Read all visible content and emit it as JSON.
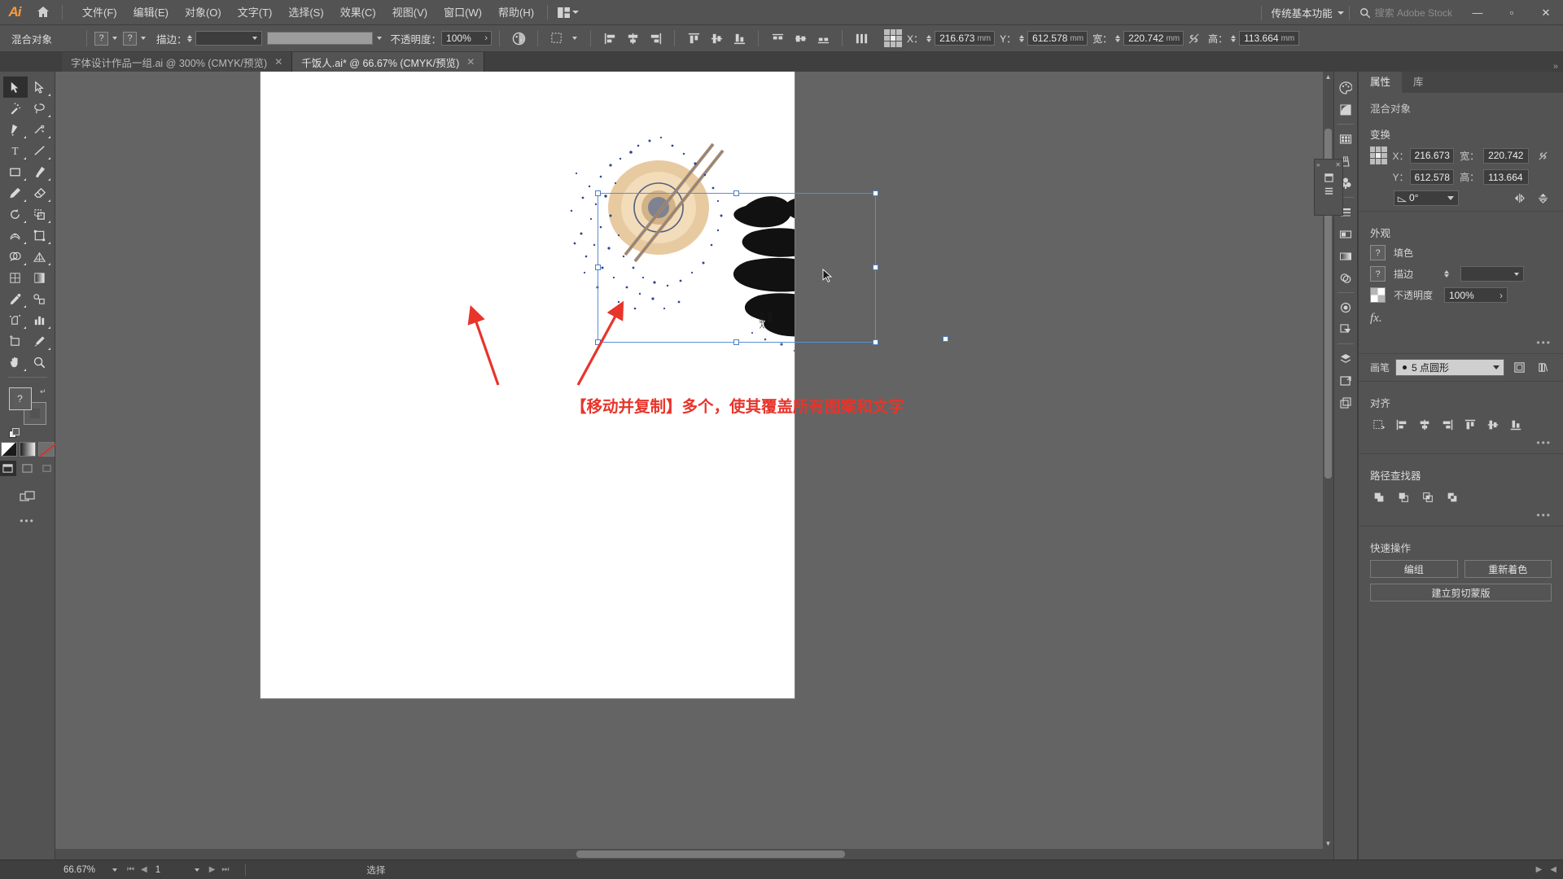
{
  "app": {
    "logo": "Ai",
    "home_icon": "home-icon",
    "workspace": "传统基本功能",
    "search_placeholder": "搜索 Adobe Stock",
    "search_icon": "search-icon",
    "window_buttons": {
      "minimize": "—",
      "maximize": "▫",
      "close": "✕"
    }
  },
  "menubar": {
    "items": [
      {
        "label": "文件(F)"
      },
      {
        "label": "编辑(E)"
      },
      {
        "label": "对象(O)"
      },
      {
        "label": "文字(T)"
      },
      {
        "label": "选择(S)"
      },
      {
        "label": "效果(C)"
      },
      {
        "label": "视图(V)"
      },
      {
        "label": "窗口(W)"
      },
      {
        "label": "帮助(H)"
      }
    ],
    "arrange_icon": "arrange-documents-icon"
  },
  "controlbar": {
    "object_label": "混合对象",
    "fill_swatch": "?",
    "stroke_swatch": "?",
    "stroke_label": "描边：",
    "stroke_value": "",
    "opacity_label": "不透明度：",
    "opacity_value": "100%",
    "icons": [
      {
        "name": "recolor-artwork-icon"
      },
      {
        "name": "select-similar-icon"
      },
      {
        "name": "align-left-icon"
      },
      {
        "name": "align-center-horizontal-icon"
      },
      {
        "name": "align-right-icon"
      },
      {
        "name": "align-top-icon"
      },
      {
        "name": "align-center-vertical-icon"
      },
      {
        "name": "align-bottom-icon"
      },
      {
        "name": "distribute-top-icon"
      },
      {
        "name": "distribute-center-icon"
      },
      {
        "name": "distribute-bottom-icon"
      },
      {
        "name": "distribute-spacing-icon"
      }
    ],
    "transform": {
      "ref_point_icon": "reference-point-grid",
      "x_label": "X：",
      "x_value": "216.673",
      "x_unit": "mm",
      "y_label": "Y：",
      "y_value": "612.578",
      "y_unit": "mm",
      "w_label": "宽：",
      "w_value": "220.742",
      "w_unit": "mm",
      "h_label": "高：",
      "h_value": "113.664",
      "h_unit": "mm",
      "link_icon": "constrain-proportions-icon",
      "lock_icon": "lock-icon"
    }
  },
  "tabs": [
    {
      "title": "字体设计作品一组.ai @ 300% (CMYK/预览)",
      "active": false,
      "close": "✕"
    },
    {
      "title": "千饭人.ai* @ 66.67% (CMYK/预览)",
      "active": true,
      "close": "✕"
    }
  ],
  "toolbar": {
    "tools": [
      {
        "name": "selection-tool",
        "active": true
      },
      {
        "name": "direct-selection-tool",
        "active": false
      },
      {
        "name": "magic-wand-tool",
        "active": false
      },
      {
        "name": "lasso-tool",
        "active": false
      },
      {
        "name": "pen-tool",
        "active": false
      },
      {
        "name": "curvature-tool",
        "active": false
      },
      {
        "name": "type-tool",
        "active": false
      },
      {
        "name": "line-segment-tool",
        "active": false
      },
      {
        "name": "rectangle-tool",
        "active": false
      },
      {
        "name": "paintbrush-tool",
        "active": false
      },
      {
        "name": "shaper-tool",
        "active": false
      },
      {
        "name": "eraser-tool",
        "active": false
      },
      {
        "name": "rotate-tool",
        "active": false
      },
      {
        "name": "scale-tool",
        "active": false
      },
      {
        "name": "width-tool",
        "active": false
      },
      {
        "name": "free-transform-tool",
        "active": false
      },
      {
        "name": "shape-builder-tool",
        "active": false
      },
      {
        "name": "perspective-grid-tool",
        "active": false
      },
      {
        "name": "mesh-tool",
        "active": false
      },
      {
        "name": "gradient-tool",
        "active": false
      },
      {
        "name": "eyedropper-tool",
        "active": false
      },
      {
        "name": "blend-tool",
        "active": false
      },
      {
        "name": "symbol-sprayer-tool",
        "active": false
      },
      {
        "name": "column-graph-tool",
        "active": false
      },
      {
        "name": "artboard-tool",
        "active": false
      },
      {
        "name": "slice-tool",
        "active": false
      },
      {
        "name": "hand-tool",
        "active": false
      },
      {
        "name": "zoom-tool",
        "active": false
      }
    ],
    "fill_label": "?",
    "swap_icon": "swap-fill-stroke-icon",
    "default_icon": "default-fill-stroke-icon",
    "color_modes": [
      {
        "name": "color-mode-button",
        "kind": "white"
      },
      {
        "name": "gradient-mode-button",
        "kind": "grad"
      },
      {
        "name": "none-mode-button",
        "kind": "none"
      }
    ],
    "screen_modes": [
      {
        "name": "normal-screen-mode"
      },
      {
        "name": "full-screen-menu-mode"
      },
      {
        "name": "full-screen-mode"
      }
    ],
    "change_screen_icon": "change-screen-mode-icon",
    "more": "•••"
  },
  "canvas": {
    "annotation": "【移动并复制】多个，使其覆盖所有图案和文字",
    "annotation_color": "#e8342a",
    "arrow_color": "#e8342a",
    "cursor_icon": "selection-cursor-icon",
    "selection_color": "#5b8fd4"
  },
  "icondock": {
    "icons": [
      {
        "name": "color-panel-icon"
      },
      {
        "name": "color-guide-panel-icon"
      },
      {
        "name": "swatches-panel-icon"
      },
      {
        "name": "brushes-panel-icon"
      },
      {
        "name": "symbols-panel-icon"
      },
      {
        "name": "stroke-panel-icon"
      },
      {
        "name": "gradient-panel-icon"
      },
      {
        "name": "transparency-panel-icon"
      },
      {
        "name": "appearance-panel-icon"
      },
      {
        "name": "graphic-styles-panel-icon"
      },
      {
        "name": "layers-panel-icon"
      },
      {
        "name": "artboards-panel-icon"
      },
      {
        "name": "asset-export-panel-icon"
      }
    ],
    "mini_panel": {
      "close": "✕",
      "collapse": "»"
    }
  },
  "properties": {
    "tabs": [
      {
        "label": "属性",
        "active": true
      },
      {
        "label": "库",
        "active": false
      }
    ],
    "object_type": "混合对象",
    "transform": {
      "title": "变换",
      "x_label": "X：",
      "x_value": "216.673",
      "y_label": "Y：",
      "y_value": "612.578",
      "w_label": "宽：",
      "w_value": "220.742",
      "h_label": "高：",
      "h_value": "113.664",
      "angle_value": "0°",
      "angle_icon": "rotate-angle-icon",
      "link_icon": "constrain-proportions-icon",
      "flip_h_icon": "flip-horizontal-icon",
      "flip_v_icon": "flip-vertical-icon"
    },
    "appearance": {
      "title": "外观",
      "fill_label": "填色",
      "fill_swatch": "?",
      "stroke_label": "描边",
      "stroke_swatch": "?",
      "opacity_label": "不透明度",
      "opacity_value": "100%",
      "fx_label": "fx.",
      "more": "•••"
    },
    "brush": {
      "label": "画笔",
      "value": "5 点圆形",
      "options_icon": "brush-options-icon",
      "libraries_icon": "brush-libraries-icon"
    },
    "align": {
      "title": "对齐",
      "buttons": [
        {
          "name": "align-to-selection-icon"
        },
        {
          "name": "align-left-icon"
        },
        {
          "name": "align-center-horizontal-icon"
        },
        {
          "name": "align-right-icon"
        },
        {
          "name": "align-top-icon"
        },
        {
          "name": "align-center-vertical-icon"
        },
        {
          "name": "align-bottom-icon"
        }
      ],
      "more": "•••"
    },
    "pathfinder": {
      "title": "路径查找器",
      "buttons": [
        {
          "name": "unite-icon"
        },
        {
          "name": "minus-front-icon"
        },
        {
          "name": "intersect-icon"
        },
        {
          "name": "exclude-icon"
        }
      ],
      "more": "•••"
    },
    "quick_actions": {
      "title": "快速操作",
      "buttons": [
        {
          "label": "编组"
        },
        {
          "label": "重新着色"
        },
        {
          "label": "建立剪切蒙版"
        }
      ]
    }
  },
  "statusbar": {
    "zoom": "66.67%",
    "page": "1",
    "tool_status": "选择",
    "first_icon": "first-page-icon",
    "prev_icon": "prev-page-icon",
    "next_icon": "next-page-icon",
    "last_icon": "last-page-icon"
  }
}
